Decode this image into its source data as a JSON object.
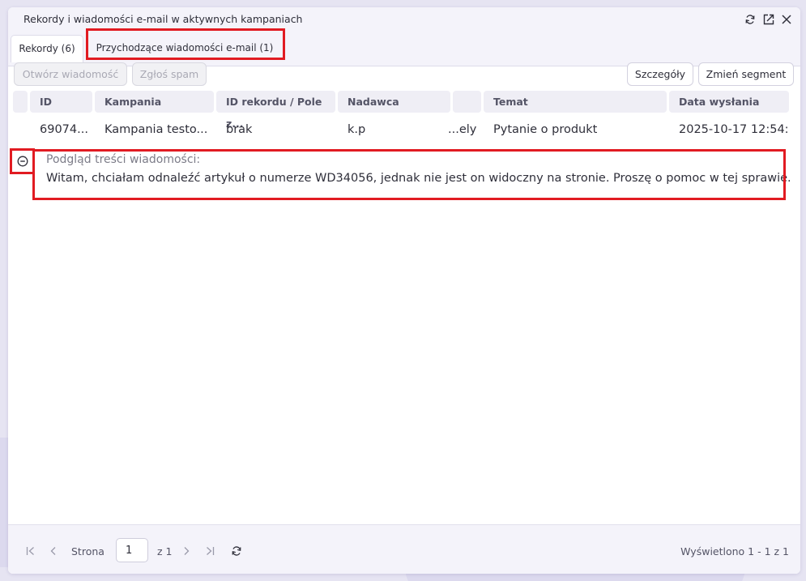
{
  "window": {
    "title": "Rekordy i wiadomości e-mail w aktywnych kampaniach",
    "controls": [
      "refresh-icon",
      "popout-icon",
      "close-icon"
    ]
  },
  "tabs": [
    {
      "label": "Rekordy (6)",
      "active": true
    },
    {
      "label": "Przychodzące wiadomości e-mail (1)",
      "active": false
    }
  ],
  "toolbar": {
    "open_message": "Otwórz wiadomość",
    "report_spam": "Zgłoś spam",
    "details": "Szczegóły",
    "change_segment": "Zmień segment"
  },
  "table": {
    "columns": [
      "ID",
      "Kampania",
      "ID rekordu / Pole z...",
      "Nadawca",
      "Temat",
      "Data wysłania"
    ],
    "row": {
      "id": "69074...",
      "campaign": "Kampania testo...",
      "record_id": "brak",
      "sender": "k.p",
      "recipient_fragment": "ely...",
      "subject": "Pytanie o produkt",
      "date": "2025-10-17 12:54:..."
    }
  },
  "preview": {
    "label": "Podgląd treści wiadomości:",
    "text": "Witam,  chciałam odnaleźć artykuł o numerze WD34056, jednak nie jest on widoczny na stronie. Proszę o pomoc w tej sprawie."
  },
  "pager": {
    "page_label": "Strona",
    "page_value": "1",
    "of_label": "z 1",
    "summary": "Wyświetlono 1 - 1 z 1"
  },
  "colors": {
    "highlight": "#e11b22",
    "header_bg": "#efeef5",
    "bar_bg": "#f4f3fa"
  }
}
